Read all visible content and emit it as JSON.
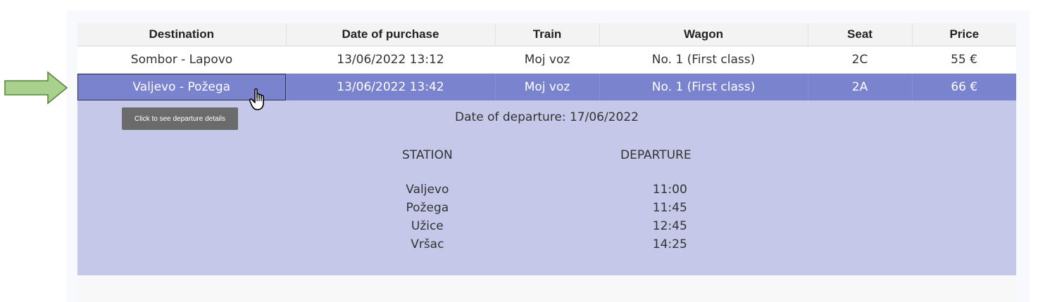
{
  "table": {
    "headers": [
      "Destination",
      "Date of purchase",
      "Train",
      "Wagon",
      "Seat",
      "Price"
    ],
    "rows": [
      {
        "destination": "Sombor - Lapovo",
        "date": "13/06/2022 13:12",
        "train": "Moj voz",
        "wagon": "No. 1 (First class)",
        "seat": "2C",
        "price": "55 €"
      },
      {
        "destination": "Valjevo - Požega",
        "date": "13/06/2022 13:42",
        "train": "Moj voz",
        "wagon": "No. 1 (First class)",
        "seat": "2A",
        "price": "66 €"
      }
    ]
  },
  "details": {
    "departure_date": "Date of departure: 17/06/2022",
    "station_header": "STATION",
    "departure_header": "DEPARTURE",
    "stops": [
      {
        "station": "Valjevo",
        "time": "11:00"
      },
      {
        "station": "Požega",
        "time": "11:45"
      },
      {
        "station": "Užice",
        "time": "12:45"
      },
      {
        "station": "Vršac",
        "time": "14:25"
      }
    ]
  },
  "tooltip": "Click to see departure details",
  "colors": {
    "selected_row": "#7a83cd",
    "details_bg": "#c5c8e8",
    "arrow_fill": "#a9d18e",
    "arrow_stroke": "#548235"
  }
}
